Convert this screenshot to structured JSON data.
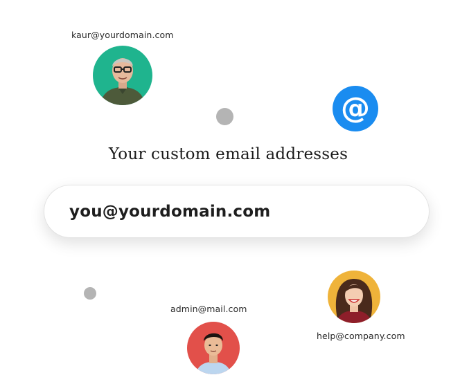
{
  "addresses": [
    {
      "label": "kaur@yourdomain.com"
    },
    {
      "label": "admin@mail.com"
    },
    {
      "label": "help@company.com"
    }
  ],
  "headline": "Your custom email addresses",
  "email_field": {
    "value": "you@yourdomain.com"
  },
  "at_symbol": "@",
  "icons": {
    "badge": "at-sign-icon"
  },
  "colors": {
    "at_badge": "#1a8cf0",
    "avatar_kaur_bg": "#1fb48e",
    "avatar_help_bg": "#efb33a",
    "avatar_admin_bg": "#e2504a",
    "dot": "#b4b4b4"
  }
}
